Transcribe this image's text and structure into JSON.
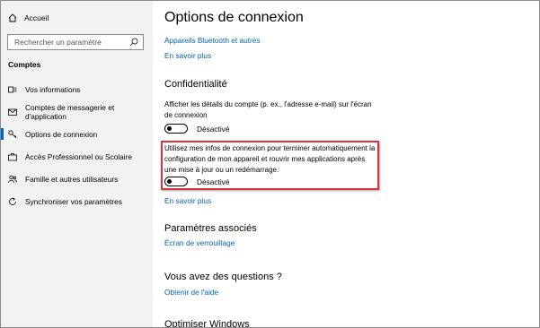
{
  "sidebar": {
    "home_label": "Accueil",
    "search_placeholder": "Rechercher un paramètre",
    "section_title": "Comptes",
    "items": [
      {
        "label": "Vos informations",
        "icon": "person-card-icon",
        "active": false
      },
      {
        "label": "Comptes de messagerie et d'application",
        "icon": "mail-icon",
        "active": false
      },
      {
        "label": "Options de connexion",
        "icon": "key-icon",
        "active": true
      },
      {
        "label": "Accès Professionnel ou Scolaire",
        "icon": "briefcase-icon",
        "active": false
      },
      {
        "label": "Famille et autres utilisateurs",
        "icon": "people-icon",
        "active": false
      },
      {
        "label": "Synchroniser vos paramètres",
        "icon": "sync-icon",
        "active": false
      }
    ]
  },
  "main": {
    "title": "Options de connexion",
    "bluetooth_link": "Appareils Bluetooth et autres",
    "learn_more_1": "En savoir plus",
    "privacy_heading": "Confidentialité",
    "privacy_setting_1": {
      "text": "Afficher les détails du compte (p. ex., l'adresse e-mail) sur l'écran de connexion",
      "state": "Désactivé"
    },
    "privacy_setting_2": {
      "text": "Utilisez mes infos de connexion pour terminer automatiquement la configuration de mon appareil et rouvrir mes applications après une mise à jour ou un redémarrage.",
      "state": "Désactivé"
    },
    "learn_more_2": "En savoir plus",
    "related_heading": "Paramètres associés",
    "lock_screen_link": "Écran de verrouillage",
    "questions_heading": "Vous avez des questions ?",
    "help_link": "Obtenir de l'aide",
    "optimize_heading": "Optimiser Windows"
  },
  "colors": {
    "accent": "#0063b1",
    "highlight": "#d9333f",
    "sidebar_bg": "#f2f2f2"
  }
}
